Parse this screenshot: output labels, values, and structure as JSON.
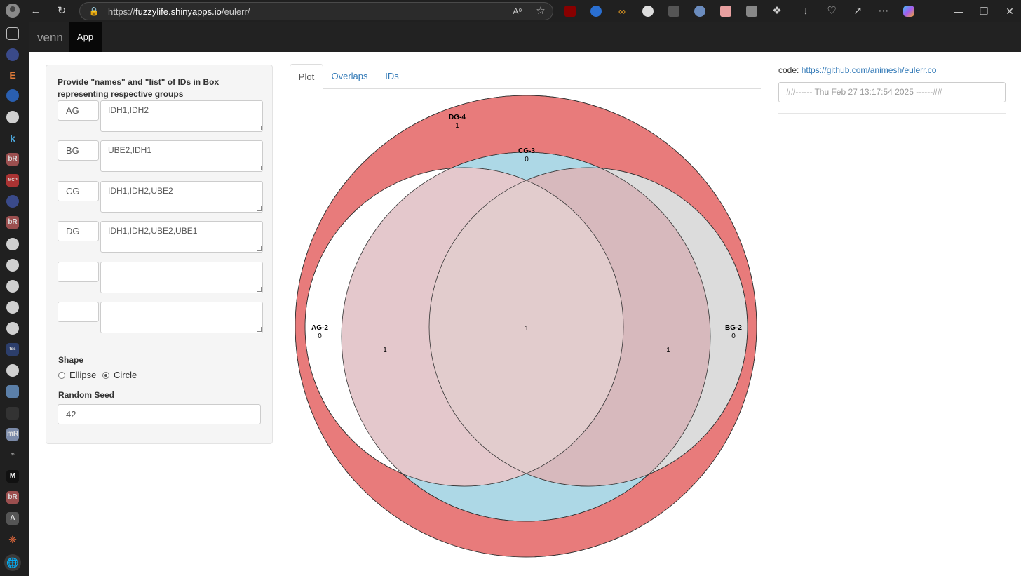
{
  "browser": {
    "url_prefix": "https://",
    "url_domain": "fuzzylife.shinyapps.io",
    "url_path": "/eulerr/"
  },
  "navbar": {
    "brand": "venn",
    "tab_app": "App"
  },
  "sidebar": {
    "title": "Provide \"names\" and \"list\" of IDs in Box representing respective groups",
    "groups": [
      {
        "name": "AG",
        "list": "IDH1,IDH2"
      },
      {
        "name": "BG",
        "list": "UBE2,IDH1"
      },
      {
        "name": "CG",
        "list": "IDH1,IDH2,UBE2"
      },
      {
        "name": "DG",
        "list": "IDH1,IDH2,UBE2,UBE1"
      },
      {
        "name": "",
        "list": ""
      },
      {
        "name": "",
        "list": ""
      }
    ],
    "shape_label": "Shape",
    "shape_options": [
      "Ellipse",
      "Circle"
    ],
    "shape_selected": "Circle",
    "seed_label": "Random Seed",
    "seed_value": "42"
  },
  "tabs": [
    "Plot",
    "Overlaps",
    "IDs"
  ],
  "active_tab": "Plot",
  "venn": {
    "sets": [
      {
        "label": "DG-4",
        "count": "1",
        "color": "#e87b7b"
      },
      {
        "label": "CG-3",
        "count": "0",
        "color": "#add8e6"
      },
      {
        "label": "AG-2",
        "count": "0",
        "color": "#ffffff"
      },
      {
        "label": "BG-2",
        "count": "0",
        "color": "#dcdcdc"
      }
    ],
    "region_counts": {
      "ag_cg_dg": "1",
      "center": "1",
      "bg_cg_dg": "1"
    }
  },
  "right_panel": {
    "code_prefix": "code: ",
    "code_link": "https://github.com/animesh/eulerr.co",
    "log_placeholder": "##------ Thu Feb 27 13:17:54 2025 ------##"
  }
}
